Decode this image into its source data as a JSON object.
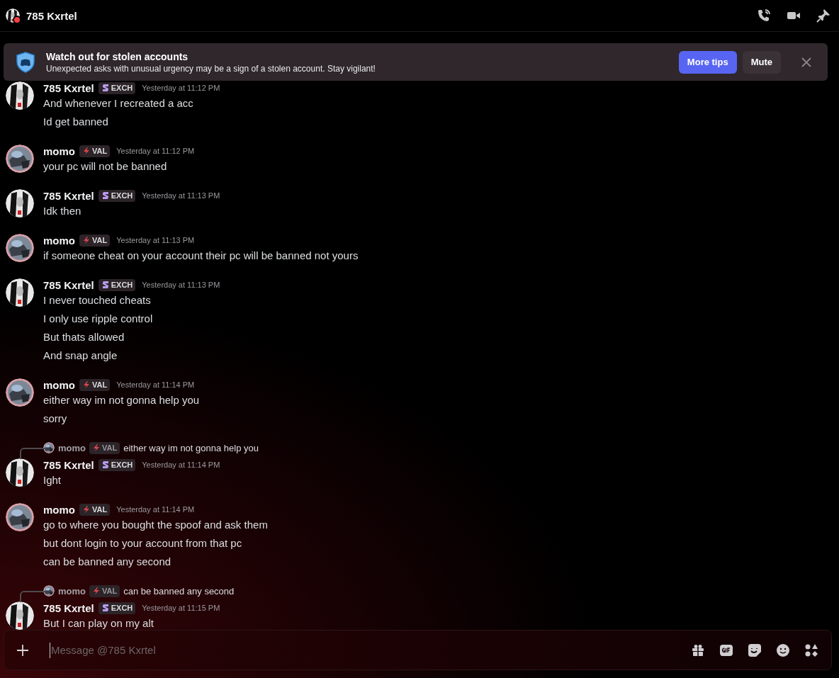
{
  "header": {
    "title": "785 Kxrtel",
    "avatar": {
      "kind": "mono"
    },
    "status": {
      "kind": "dnd"
    }
  },
  "banner": {
    "title": "Watch out for stolen accounts",
    "text": "Unexpected asks with unusual urgency may be a sign of a stolen account. Stay vigilant!",
    "buttons": [
      {
        "label": "More tips",
        "kind": "primary"
      },
      {
        "label": "Mute",
        "kind": "secondary"
      }
    ]
  },
  "messages": [
    {
      "author": "785 Kxrtel",
      "avatar": {
        "kind": "mono"
      },
      "badge": {
        "kind": "exch",
        "text": "EXCH"
      },
      "time": "Yesterday at 11:12 PM",
      "lines": [
        "And whenever I recreated a acc",
        "Id get banned"
      ]
    },
    {
      "author": "momo",
      "avatar": {
        "kind": "photo"
      },
      "badge": {
        "kind": "val",
        "text": "VAL"
      },
      "time": "Yesterday at 11:12 PM",
      "lines": [
        "your pc will not be banned"
      ]
    },
    {
      "author": "785 Kxrtel",
      "avatar": {
        "kind": "mono"
      },
      "badge": {
        "kind": "exch",
        "text": "EXCH"
      },
      "time": "Yesterday at 11:13 PM",
      "lines": [
        "Idk then"
      ]
    },
    {
      "author": "momo",
      "avatar": {
        "kind": "photo"
      },
      "badge": {
        "kind": "val",
        "text": "VAL"
      },
      "time": "Yesterday at 11:13 PM",
      "lines": [
        "if someone cheat on your account their pc will be banned not yours"
      ]
    },
    {
      "author": "785 Kxrtel",
      "avatar": {
        "kind": "mono"
      },
      "badge": {
        "kind": "exch",
        "text": "EXCH"
      },
      "time": "Yesterday at 11:13 PM",
      "lines": [
        "I never touched cheats",
        "I only use ripple control",
        "But thats allowed",
        "And snap angle"
      ]
    },
    {
      "author": "momo",
      "avatar": {
        "kind": "photo"
      },
      "badge": {
        "kind": "val",
        "text": "VAL"
      },
      "time": "Yesterday at 11:14 PM",
      "lines": [
        "either way im not gonna help you",
        "sorry"
      ]
    },
    {
      "author": "785 Kxrtel",
      "avatar": {
        "kind": "mono"
      },
      "badge": {
        "kind": "exch",
        "text": "EXCH"
      },
      "time": "Yesterday at 11:14 PM",
      "reply": {
        "author": "momo",
        "avatar": {
          "kind": "photo"
        },
        "badge": {
          "kind": "val",
          "text": "VAL"
        },
        "text": "either way im not gonna help you"
      },
      "lines": [
        "Ight"
      ]
    },
    {
      "author": "momo",
      "avatar": {
        "kind": "photo"
      },
      "badge": {
        "kind": "val",
        "text": "VAL"
      },
      "time": "Yesterday at 11:14 PM",
      "lines": [
        "go to where you bought the spoof and ask them",
        "but dont login to your account from that pc",
        "can be banned any second"
      ]
    },
    {
      "author": "785 Kxrtel",
      "avatar": {
        "kind": "mono"
      },
      "badge": {
        "kind": "exch",
        "text": "EXCH"
      },
      "time": "Yesterday at 11:15 PM",
      "reply": {
        "author": "momo",
        "avatar": {
          "kind": "photo"
        },
        "badge": {
          "kind": "val",
          "text": "VAL"
        },
        "text": "can be banned any second"
      },
      "lines": [
        "But I can play on my alt"
      ]
    }
  ],
  "composer": {
    "placeholder": "Message @785 Kxrtel"
  }
}
